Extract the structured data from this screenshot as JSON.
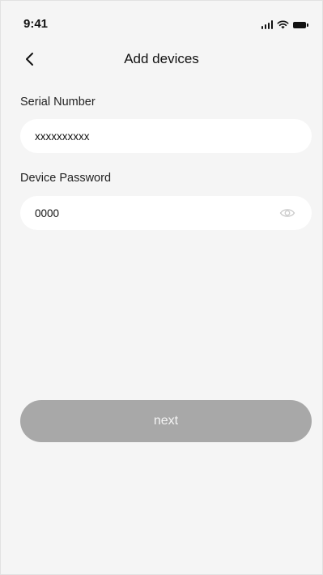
{
  "status_bar": {
    "time": "9:41",
    "icons": [
      "signal-icon",
      "wifi-icon",
      "battery-icon"
    ]
  },
  "nav": {
    "title": "Add devices",
    "back_icon": "chevron-left-icon"
  },
  "form": {
    "serial": {
      "label": "Serial Number",
      "value": "xxxxxxxxxx"
    },
    "password": {
      "label": "Device Password",
      "value": "0000",
      "toggle_icon": "eye-icon"
    }
  },
  "actions": {
    "next_label": "next",
    "next_color": "#a8a8a8"
  },
  "colors": {
    "background": "#f5f5f5",
    "field_background": "#ffffff",
    "text": "#111111"
  }
}
